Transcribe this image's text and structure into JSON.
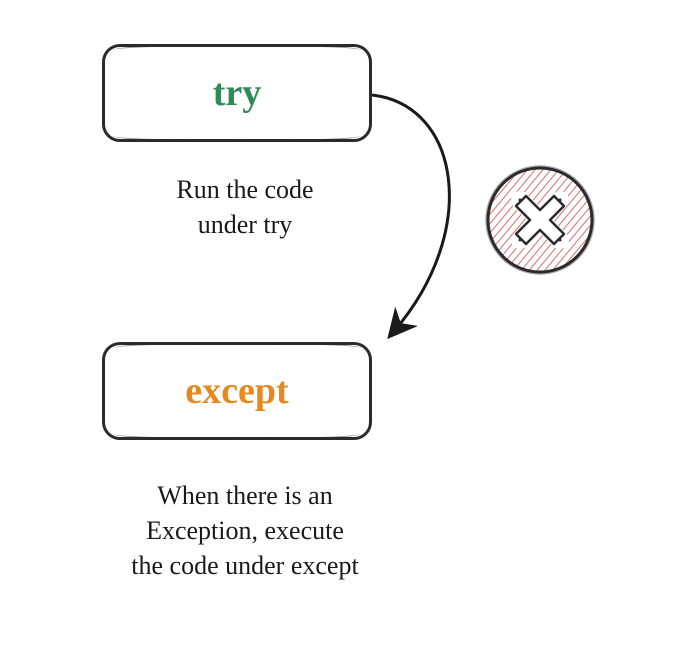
{
  "try_box": {
    "label": "try"
  },
  "except_box": {
    "label": "except"
  },
  "caption_try": {
    "line1": "Run the code",
    "line2": "under try"
  },
  "caption_except": {
    "line1": "When there is an",
    "line2": "Exception, execute",
    "line3": "the code under except"
  },
  "colors": {
    "try": "#2e8b57",
    "except": "#e68a1f",
    "stroke": "#2b2b2b",
    "error": "#c95c5c"
  }
}
